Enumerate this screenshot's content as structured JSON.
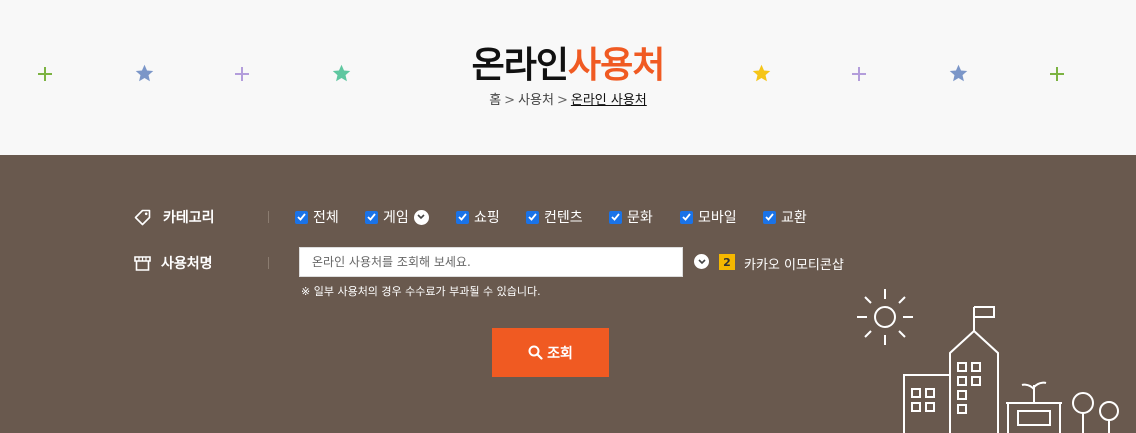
{
  "header": {
    "title_plain": "온라인",
    "title_accent": "사용처",
    "colors": {
      "accent": "#f05a22",
      "panel_bg": "#69594e",
      "page_bg": "#f8f8f8",
      "checkbox": "#1a73e8",
      "badge": "#f5b800"
    }
  },
  "breadcrumb": {
    "items": [
      "홈",
      "사용처",
      "온라인 사용처"
    ],
    "separator": ">"
  },
  "decorations": [
    "plus-icon-green",
    "star-icon-blue",
    "plus-icon-purple",
    "star-icon-teal",
    "star-icon-yellow",
    "plus-icon-purple",
    "star-icon-blue",
    "plus-icon-green"
  ],
  "filter": {
    "category_label": "카테고리",
    "categories": [
      {
        "label": "전체",
        "checked": true
      },
      {
        "label": "게임",
        "checked": true,
        "has_dropdown": true
      },
      {
        "label": "쇼핑",
        "checked": true
      },
      {
        "label": "컨텐츠",
        "checked": true
      },
      {
        "label": "문화",
        "checked": true
      },
      {
        "label": "모바일",
        "checked": true
      },
      {
        "label": "교환",
        "checked": true
      }
    ],
    "name_label": "사용처명",
    "search_placeholder": "온라인 사용처를 조회해 보세요.",
    "suggestion_rank": "2",
    "suggestion_text": "카카오 이모티콘샵",
    "notice": "※ 일부 사용처의 경우 수수료가 부과될 수 있습니다.",
    "search_button": "조회"
  }
}
